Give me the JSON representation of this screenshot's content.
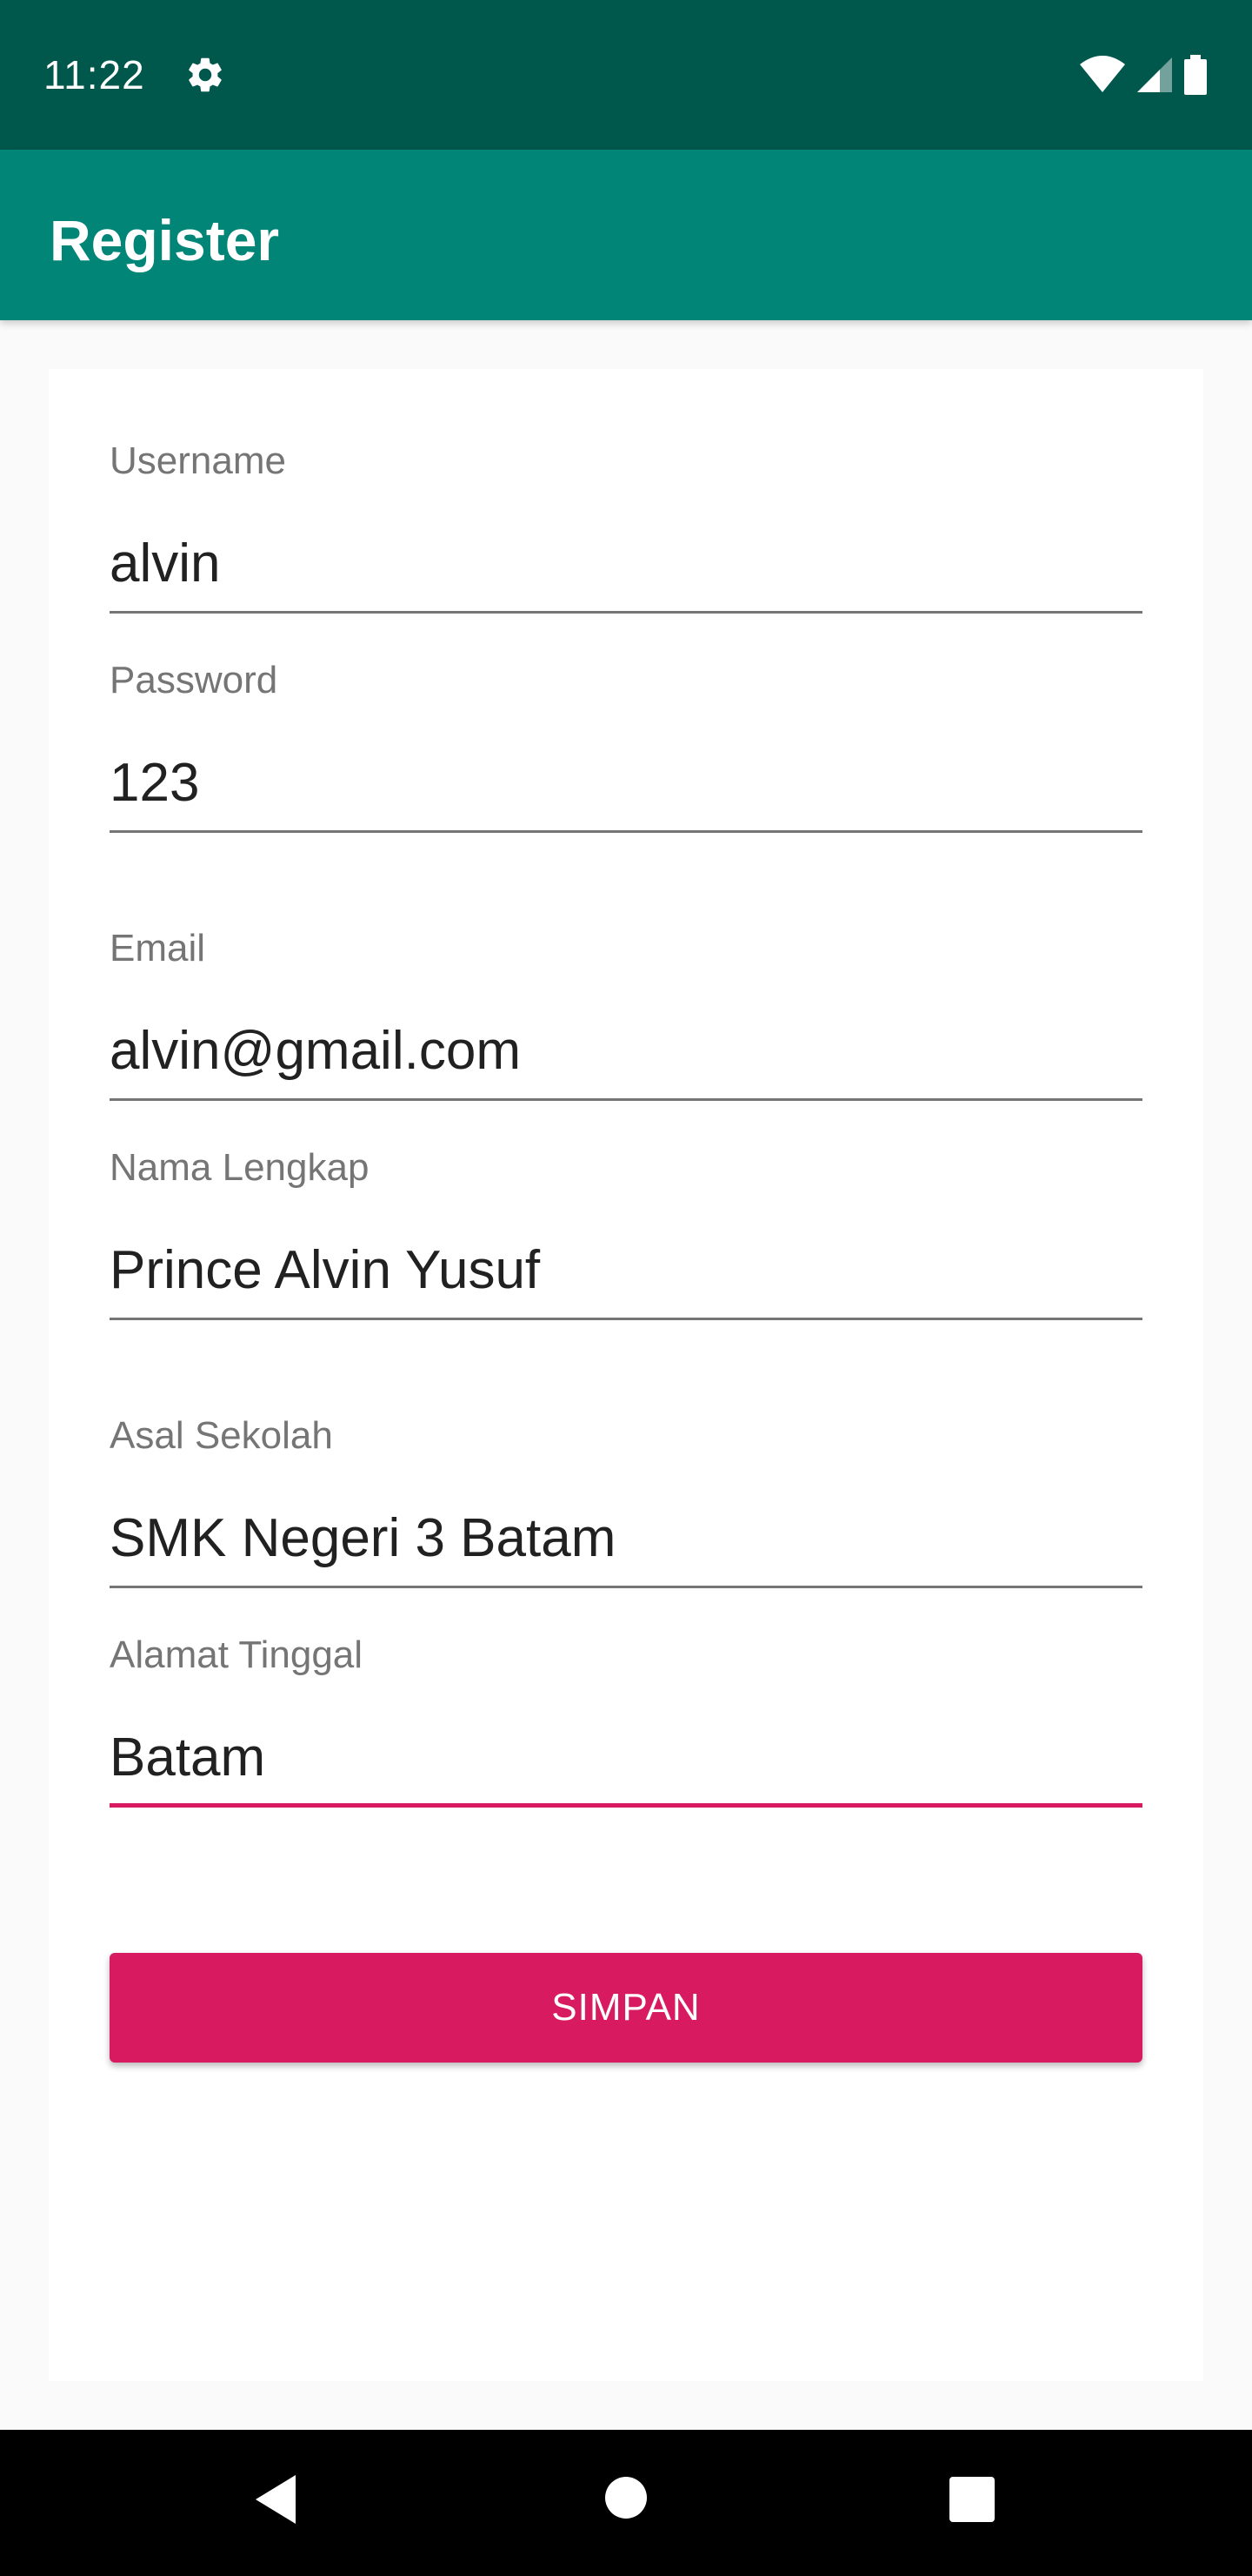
{
  "status_bar": {
    "time": "11:22",
    "icons": [
      "gear-icon",
      "wifi-icon",
      "signal-icon",
      "battery-icon"
    ]
  },
  "app_bar": {
    "title": "Register"
  },
  "form": {
    "fields": [
      {
        "label": "Username",
        "value": "alvin"
      },
      {
        "label": "Password",
        "value": "123"
      },
      {
        "label": "Email",
        "value": "alvin@gmail.com"
      },
      {
        "label": "Nama Lengkap",
        "value": "Prince Alvin Yusuf"
      },
      {
        "label": "Asal Sekolah",
        "value": "SMK Negeri 3 Batam"
      },
      {
        "label": "Alamat Tinggal",
        "value": "Batam"
      }
    ],
    "focused_field": "Alamat Tinggal",
    "submit_label": "SIMPAN"
  },
  "nav_bar": {
    "icons": [
      "back-icon",
      "home-icon",
      "recents-icon"
    ]
  },
  "colors": {
    "status_bar": "#00574b",
    "primary": "#008577",
    "accent": "#d81b60",
    "background": "#fafafa",
    "card": "#ffffff"
  }
}
